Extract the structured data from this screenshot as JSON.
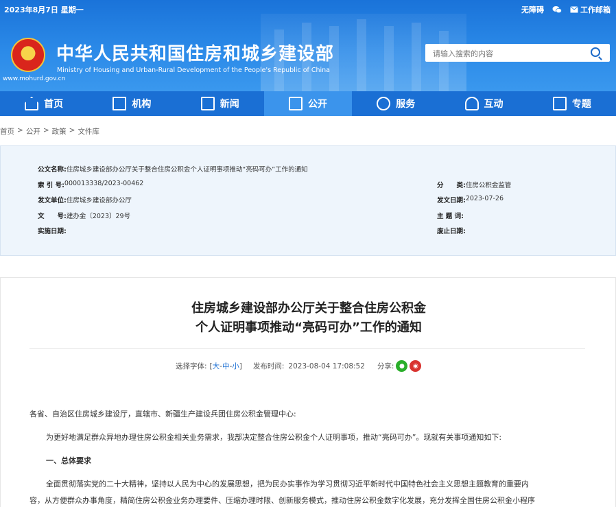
{
  "topbar": {
    "date": "2023年8月7日 星期一",
    "links": [
      "无障碍",
      "",
      "工作邮箱"
    ],
    "wechat_icon": "wechat-icon",
    "mail_icon": "mail-icon"
  },
  "header": {
    "title_cn": "中华人民共和国住房和城乡建设部",
    "title_en": "Ministry of Housing and Urban-Rural Development of the People's Republic of China",
    "url": "www.mohurd.gov.cn",
    "search_placeholder": "请输入搜索的内容"
  },
  "nav": {
    "items": [
      {
        "label": "首页",
        "icon": "home-icon"
      },
      {
        "label": "机构",
        "icon": "building-icon"
      },
      {
        "label": "新闻",
        "icon": "news-icon"
      },
      {
        "label": "公开",
        "icon": "disclosure-icon",
        "active": true
      },
      {
        "label": "服务",
        "icon": "service-icon"
      },
      {
        "label": "互动",
        "icon": "interact-icon"
      },
      {
        "label": "专题",
        "icon": "topic-icon"
      }
    ]
  },
  "breadcrumb": [
    "首页",
    ">",
    "公开",
    ">",
    "政策",
    ">",
    "文件库"
  ],
  "info": {
    "doc_name_k": "公文名称:",
    "doc_name_v": "住房城乡建设部办公厅关于整合住房公积金个人证明事项推动“亮码可办”工作的通知",
    "index_k": "索 引 号:",
    "index_v": "000013338/2023-00462",
    "category_k": "分　　类:",
    "category_v": "住房公积金监管",
    "issuer_k": "发文单位:",
    "issuer_v": "住房城乡建设部办公厅",
    "date_k": "发文日期:",
    "date_v": "2023-07-26",
    "docno_k": "文　　号:",
    "docno_v": "建办金〔2023〕29号",
    "subject_k": "主 题 词:",
    "subject_v": "",
    "impl_k": "实施日期:",
    "impl_v": "",
    "expire_k": "废止日期:",
    "expire_v": ""
  },
  "article": {
    "title_line1": "住房城乡建设部办公厅关于整合住房公积金",
    "title_line2": "个人证明事项推动“亮码可办”工作的通知",
    "font_label": "选择字体:",
    "font_open": "[",
    "font_large": "大",
    "font_sep1": " - ",
    "font_medium": "中",
    "font_sep2": " - ",
    "font_small": "小",
    "font_close": "]",
    "publish_label": "发布时间:",
    "publish_time": "2023-08-04 17:08:52",
    "share_label": "分享:",
    "para1": "各省、自治区住房城乡建设厅，直辖市、新疆生产建设兵团住房公积金管理中心:",
    "para2": "为更好地满足群众异地办理住房公积金相关业务需求，我部决定整合住房公积金个人证明事项，推动“亮码可办”。现就有关事项通知如下:",
    "heading1": "一、总体要求",
    "para3a": "全面贯彻落实党的二十大精神，坚持以人民为中心的发展思想，把为民办实事作为学习贯彻习近平新时代中国特色社会主义思想主题教育的重要内",
    "para3b": "容，从方便群众办事角度，精简住房公积金业务办理要件、压缩办理时限、创新服务模式，推动住房公积金数字化发展，充分发挥全国住房公积金小程序"
  }
}
